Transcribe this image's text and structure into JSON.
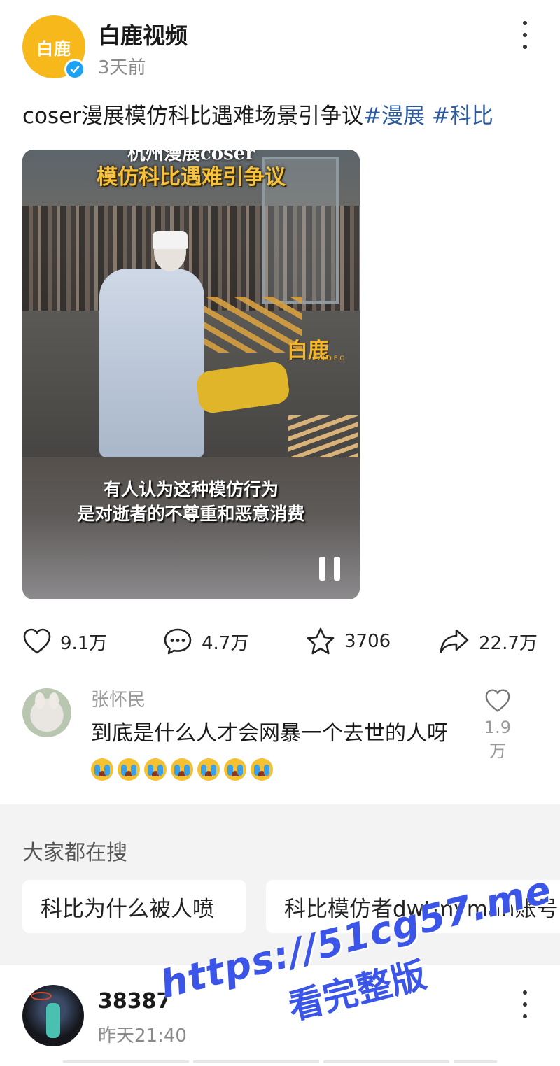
{
  "post": {
    "author": "白鹿视频",
    "avatar_logo_text": "白鹿",
    "time": "3天前",
    "text": "coser漫展模仿科比遇难场景引争议",
    "hashtags": [
      "#漫展",
      "#科比"
    ]
  },
  "video": {
    "title_line1": "杭州漫展coser",
    "title_line2": "模仿科比遇难引争议",
    "watermark": "白鹿",
    "watermark_sub": "VIDEO",
    "subtitle_line1": "有人认为这种模仿行为",
    "subtitle_line2": "是对逝者的不尊重和恶意消费",
    "playing": true
  },
  "actions": {
    "likes": "9.1万",
    "comments": "4.7万",
    "favorites": "3706",
    "shares": "22.7万"
  },
  "top_comment": {
    "user": "张怀民",
    "text": "到底是什么人才会网暴一个去世的人呀",
    "emoji_count": 7,
    "emoji": "loudly-crying-face",
    "likes": "1.9万"
  },
  "trending": {
    "title": "大家都在搜",
    "queries": [
      "科比为什么被人喷",
      "科比模仿者dwtmyman账号"
    ]
  },
  "next_post": {
    "author": "38387",
    "time": "昨天21:40"
  },
  "promo": {
    "url": "https://51cg57.me",
    "text": "看完整版"
  },
  "colors": {
    "hashtag": "#2b5a9e",
    "verified": "#1da1f2",
    "avatar_bg": "#f7b81c",
    "promo": "#3a55e8",
    "section_bg": "#f3f3f3"
  }
}
